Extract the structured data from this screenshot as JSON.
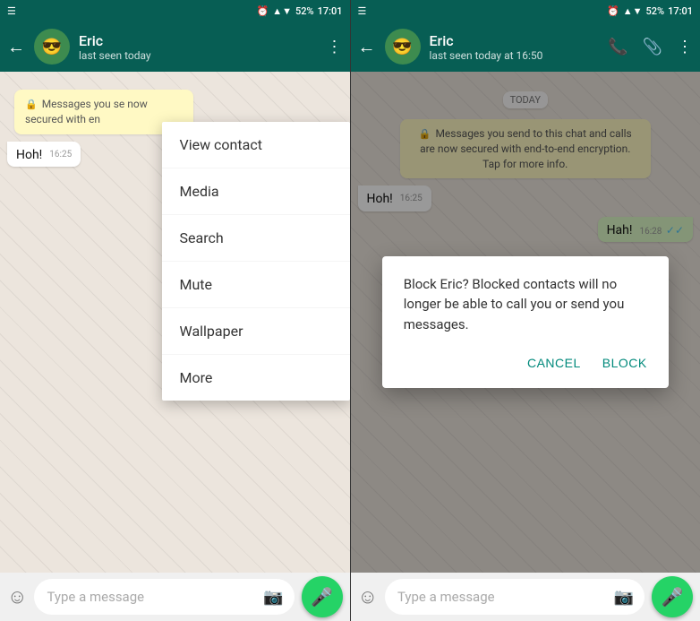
{
  "app": {
    "title": "WhatsApp Chat - Eric"
  },
  "status_bar": {
    "left_icon": "☰",
    "battery": "52%",
    "time": "17:01",
    "signal_icon": "▲",
    "wifi_icon": "▼"
  },
  "left_panel": {
    "header": {
      "back_label": "←",
      "contact_name": "Eric",
      "status": "last seen today",
      "avatar_emoji": "😎"
    },
    "encryption_notice": "Messages you se now secured with en",
    "messages": [
      {
        "text": "Hoh!",
        "time": "16:25",
        "type": "incoming"
      }
    ],
    "dropdown": {
      "items": [
        "View contact",
        "Media",
        "Search",
        "Mute",
        "Wallpaper",
        "More"
      ]
    },
    "input": {
      "placeholder": "Type a message"
    }
  },
  "right_panel": {
    "header": {
      "back_label": "←",
      "contact_name": "Eric",
      "status": "last seen today at 16:50",
      "avatar_emoji": "😎"
    },
    "date_label": "TODAY",
    "encryption_notice": "Messages you send to this chat and calls are now secured with end-to-end encryption. Tap for more info.",
    "messages": [
      {
        "text": "Hoh!",
        "time": "16:25",
        "type": "incoming"
      },
      {
        "text": "Hah!",
        "time": "16:28",
        "type": "outgoing",
        "ticks": "✓✓"
      }
    ],
    "dialog": {
      "text": "Block Eric? Blocked contacts will no longer be able to call you or send you messages.",
      "cancel_label": "CANCEL",
      "block_label": "BLOCK"
    },
    "input": {
      "placeholder": "Type a message"
    }
  }
}
